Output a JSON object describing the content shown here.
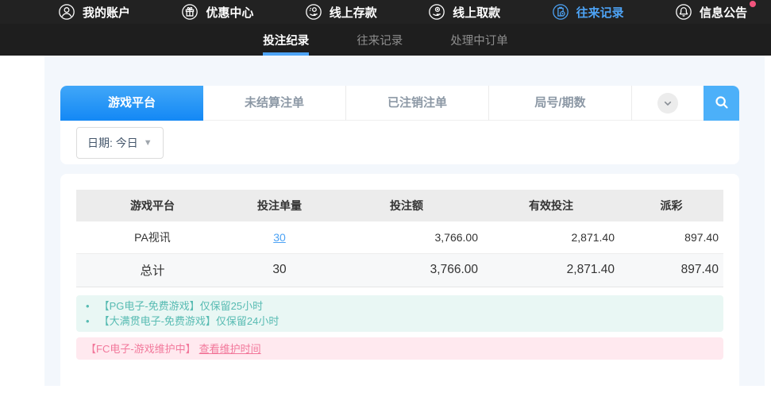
{
  "topnav": {
    "items": [
      {
        "label": "我的账户",
        "icon": "user-icon"
      },
      {
        "label": "优惠中心",
        "icon": "gift-icon"
      },
      {
        "label": "线上存款",
        "icon": "deposit-icon"
      },
      {
        "label": "线上取款",
        "icon": "withdraw-icon"
      },
      {
        "label": "往来记录",
        "icon": "records-icon",
        "active": true
      },
      {
        "label": "信息公告",
        "icon": "bell-icon"
      }
    ]
  },
  "subnav": {
    "tabs": [
      {
        "label": "投注纪录",
        "active": true
      },
      {
        "label": "往来记录",
        "active": false
      },
      {
        "label": "处理中订单",
        "active": false
      }
    ]
  },
  "filters": {
    "tabs": [
      "游戏平台",
      "未结算注单",
      "已注销注单",
      "局号/期数"
    ],
    "active_tab": "游戏平台",
    "date_label": "日期: 今日"
  },
  "table": {
    "headers": [
      "游戏平台",
      "投注单量",
      "投注额",
      "有效投注",
      "派彩"
    ],
    "rows": [
      {
        "platform": "PA视讯",
        "count": "30",
        "amount": "3,766.00",
        "valid": "2,871.40",
        "payout": "897.40"
      }
    ],
    "total": {
      "platform": "总计",
      "count": "30",
      "amount": "3,766.00",
      "valid": "2,871.40",
      "payout": "897.40"
    }
  },
  "notes": [
    "【PG电子-免费游戏】仅保留25小时",
    "【大满贯电子-免费游戏】仅保留24小时"
  ],
  "maintenance": {
    "text": "【FC电子-游戏维护中】",
    "link": "查看维护时间"
  },
  "colors": {
    "accent_blue": "#4da3f5",
    "tab_gradient_top": "#41a7f8",
    "tab_gradient_bottom": "#1388f5",
    "search_button_blue": "#4cb0f9",
    "note_teal": "#57bbb2",
    "note_bg": "#e9f7f4",
    "warning_pink": "#f2789b",
    "warning_bg": "#ffe9ef",
    "page_bg": "#f3f7fc",
    "topnav_bg": "#222222",
    "subnav_bg": "#1e1e1e"
  }
}
